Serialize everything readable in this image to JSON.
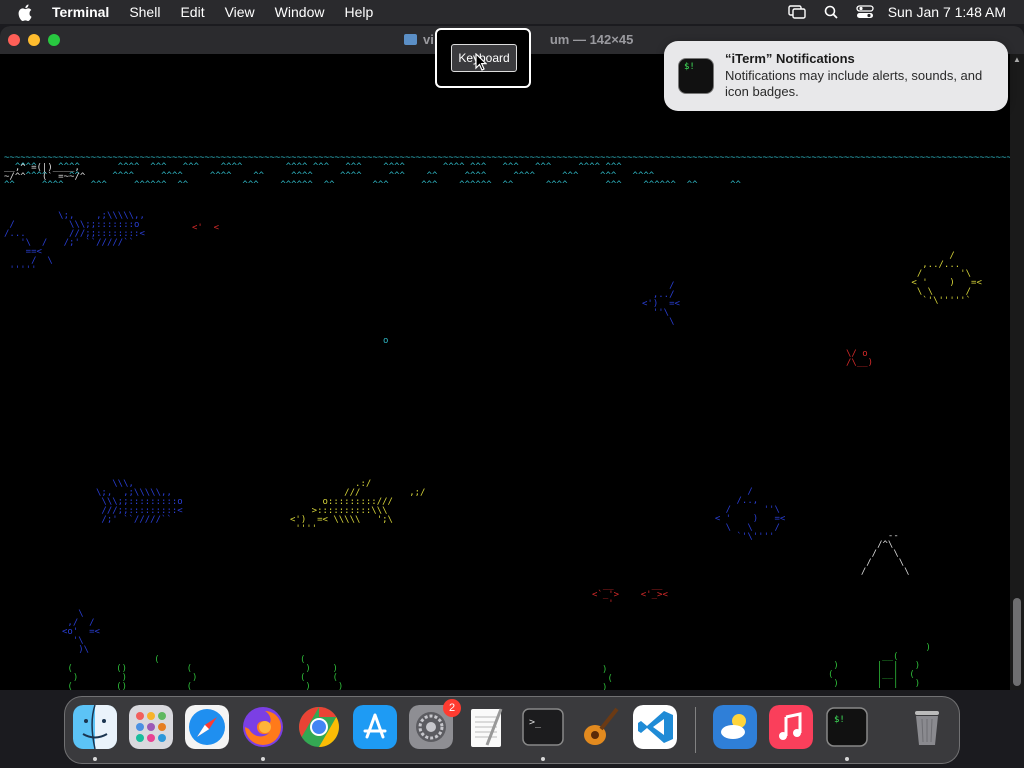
{
  "menubar": {
    "app_name": "Terminal",
    "items": [
      "Shell",
      "Edit",
      "View",
      "Window",
      "Help"
    ],
    "clock": "Sun Jan 7  1:48 AM"
  },
  "window": {
    "title": "vi",
    "title_suffix": "um — 142×45"
  },
  "tooltip": {
    "label": "Keyboard"
  },
  "notification": {
    "title": "“iTerm” Notifications",
    "body": "Notifications may include alerts, sounds, and icon badges.",
    "icon_text": "$!"
  },
  "dock": {
    "items": [
      {
        "name": "Finder",
        "running": true
      },
      {
        "name": "Launchpad",
        "running": false
      },
      {
        "name": "Safari",
        "running": false
      },
      {
        "name": "Firefox",
        "running": true
      },
      {
        "name": "Google Chrome",
        "running": false
      },
      {
        "name": "App Store",
        "running": false
      },
      {
        "name": "System Settings",
        "running": false,
        "badge": "2"
      },
      {
        "name": "TextEdit",
        "running": false
      },
      {
        "name": "Terminal",
        "running": true
      },
      {
        "name": "GarageBand",
        "running": false
      },
      {
        "name": "Visual Studio Code",
        "running": false
      },
      {
        "name": "Weather",
        "running": false
      },
      {
        "name": "Music",
        "running": false
      },
      {
        "name": "iTerm",
        "running": true
      },
      {
        "name": "Trash",
        "running": false
      }
    ]
  },
  "colors": {
    "water": "#2fb7c4",
    "fish_blue": "#2a3fd6",
    "fish_red": "#d42a2a",
    "fish_yellow": "#d7d53a",
    "seaweed": "#2fbf3a",
    "notification_bg": "#e8e8ea"
  }
}
